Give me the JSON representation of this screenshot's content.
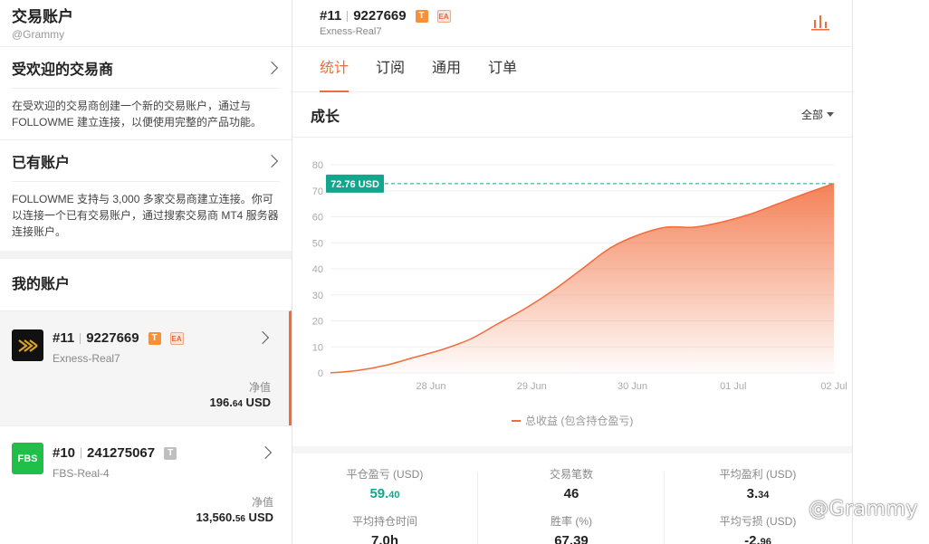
{
  "account": {
    "title": "交易账户",
    "handle": "@Grammy"
  },
  "popular": {
    "title": "受欢迎的交易商",
    "desc": "在受欢迎的交易商创建一个新的交易账户，通过与 FOLLOWME 建立连接，以便使用完整的产品功能。"
  },
  "existing": {
    "title": "已有账户",
    "desc": "FOLLOWME 支持与 3,000 多家交易商建立连接。你可以连接一个已有交易账户，通过搜索交易商 MT4 服务器连接账户。"
  },
  "my_accounts": {
    "title": "我的账户",
    "items": [
      {
        "num": "#11",
        "id": "9227669",
        "server": "Exness-Real7",
        "equity_label": "净值",
        "equity_main": "196.",
        "equity_dec": "64",
        "equity_unit": " USD",
        "logo": "exness",
        "badges": [
          "T",
          "EA"
        ]
      },
      {
        "num": "#10",
        "id": "241275067",
        "server": "FBS-Real-4",
        "equity_label": "净值",
        "equity_main": "13,560.",
        "equity_dec": "56",
        "equity_unit": " USD",
        "logo": "FBS",
        "badges": [
          "T"
        ]
      }
    ]
  },
  "detail": {
    "num": "#11",
    "id": "9227669",
    "server": "Exness-Real7",
    "tabs": [
      "统计",
      "订阅",
      "通用",
      "订单"
    ],
    "active_tab": 0,
    "growth_title": "成长",
    "filter_label": "全部"
  },
  "chart_data": {
    "type": "area",
    "x_labels": [
      "28 Jun",
      "29 Jun",
      "30 Jun",
      "01 Jul",
      "02 Jul"
    ],
    "y_ticks": [
      0,
      10,
      20,
      30,
      40,
      50,
      60,
      70,
      80
    ],
    "ylim": [
      0,
      80
    ],
    "series": [
      {
        "name": "总收益 (包含持仓盈亏)",
        "values": [
          0,
          1,
          3,
          6,
          9,
          13,
          19,
          25,
          32,
          40,
          48,
          53,
          56,
          56,
          58,
          61,
          65,
          69,
          72.76
        ]
      }
    ],
    "current_label": "72.76 USD",
    "current_value": 72.76,
    "color": "#f26b3a",
    "marker_color": "#14a58d"
  },
  "stats": [
    {
      "label": "平仓盈亏 (USD)",
      "main": "59.",
      "dec": "40",
      "color": "green"
    },
    {
      "label": "交易笔数",
      "main": "46",
      "dec": ""
    },
    {
      "label": "平均盈利 (USD)",
      "main": "3.",
      "dec": "34"
    },
    {
      "label": "平均持仓时间",
      "main": "7.0h",
      "dec": ""
    },
    {
      "label": "胜率 (%)",
      "main": "67.39",
      "dec": ""
    },
    {
      "label": "平均亏损 (USD)",
      "main": "-2.",
      "dec": "96"
    }
  ],
  "watermark": "@Grammy",
  "colors": {
    "accent": "#f26b3a",
    "green": "#14a58d"
  }
}
